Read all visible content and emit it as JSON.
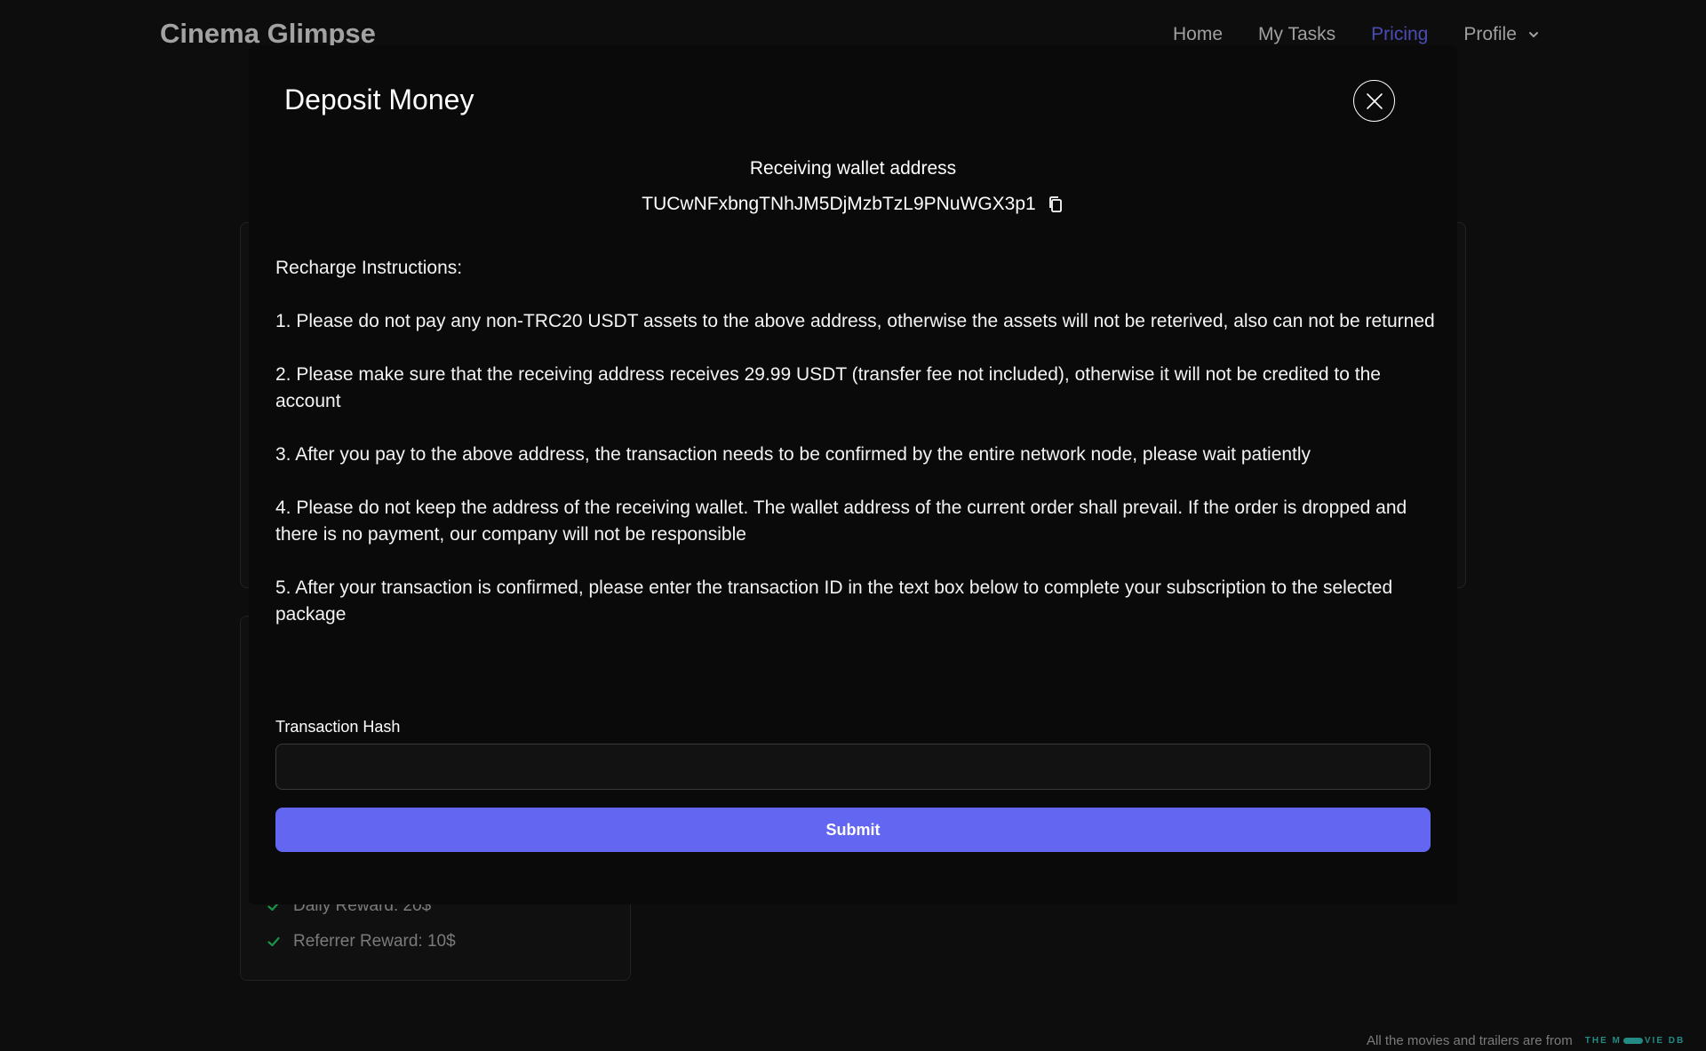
{
  "app": {
    "brand": "Cinema Glimpse"
  },
  "nav": {
    "items": [
      {
        "label": "Home",
        "active": false
      },
      {
        "label": "My Tasks",
        "active": false
      },
      {
        "label": "Pricing",
        "active": true
      }
    ],
    "profile_label": "Profile"
  },
  "background": {
    "features": [
      {
        "label": "Daily Reward: 20$"
      },
      {
        "label": "Referrer Reward: 10$"
      }
    ],
    "footer_text": "All the movies and trailers are from",
    "footer_logo_left": "THE M",
    "footer_logo_right": "VIE DB"
  },
  "modal": {
    "title": "Deposit Money",
    "wallet_label": "Receiving wallet address",
    "wallet_address": "TUCwNFxbngTNhJM5DjMzbTzL9PNuWGX3p1",
    "instructions_title": "Recharge Instructions:",
    "instructions": [
      "1. Please do not pay any non-TRC20 USDT assets to the above address, otherwise the assets will not be reterived, also can not be returned",
      "2. Please make sure that the receiving address receives 29.99 USDT (transfer fee not included), otherwise it will not be credited to the account",
      "3. After you pay to the above address, the transaction needs to be confirmed by the entire network node, please wait patiently",
      "4. Please do not keep the address of the receiving wallet. The wallet address of the current order shall prevail. If the order is dropped and there is no payment, our company will not be responsible",
      "5. After your transaction is confirmed, please enter the transaction ID in the text box below to complete your subscription to the selected package"
    ],
    "hash_label": "Transaction Hash",
    "hash_value": "",
    "hash_placeholder": "",
    "submit_label": "Submit"
  },
  "colors": {
    "accent": "#6366f1",
    "modal_bg": "#0a0a0a",
    "page_bg": "#121212",
    "check": "#22c55e"
  },
  "icons": {
    "close": "close-icon",
    "copy": "copy-icon",
    "chevron": "chevron-down-icon",
    "check": "check-icon"
  }
}
